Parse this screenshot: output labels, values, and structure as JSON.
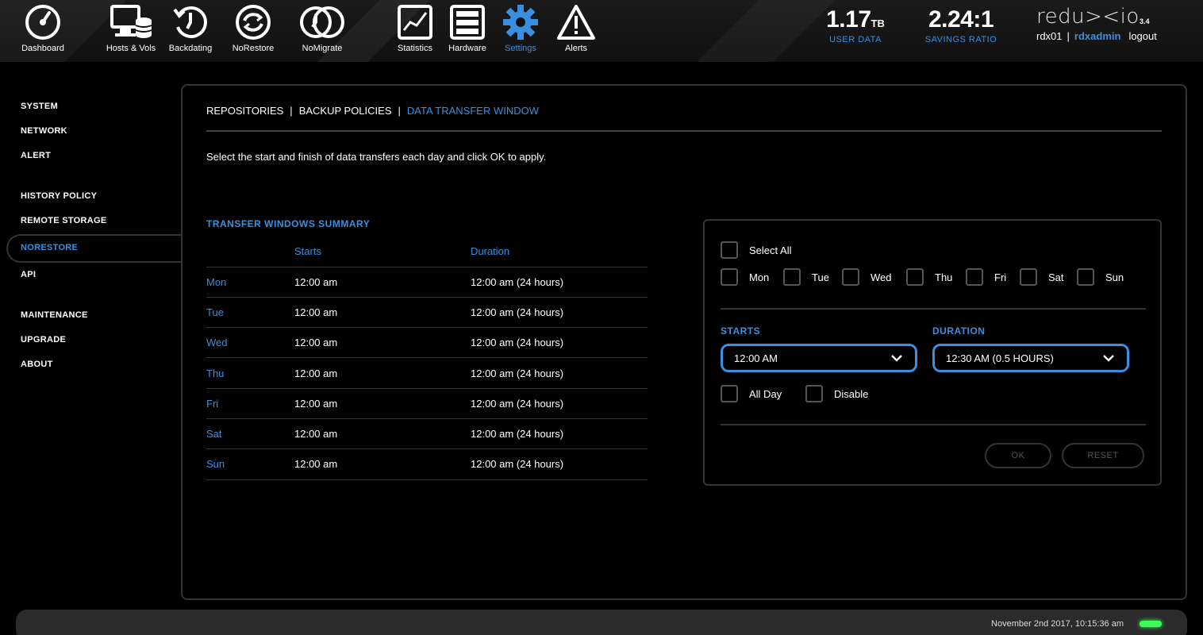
{
  "topnav": {
    "items": [
      {
        "label": "Dashboard",
        "icon": "gauge-icon"
      },
      {
        "label": "Hosts & Vols",
        "icon": "hosts-volumes-icon"
      },
      {
        "label": "Backdating",
        "icon": "backdating-clock-icon"
      },
      {
        "label": "NoRestore",
        "icon": "norestore-icon"
      },
      {
        "label": "NoMigrate",
        "icon": "nomigrate-icon"
      },
      {
        "label": "Statistics",
        "icon": "statistics-chart-icon"
      },
      {
        "label": "Hardware",
        "icon": "hardware-rack-icon"
      },
      {
        "label": "Settings",
        "icon": "gear-icon"
      },
      {
        "label": "Alerts",
        "icon": "warning-icon"
      }
    ],
    "active": "Settings"
  },
  "stats": {
    "user_data": {
      "value": "1.17",
      "unit": "TB",
      "label": "USER DATA"
    },
    "savings": {
      "value": "2.24:1",
      "label": "SAVINGS RATIO"
    }
  },
  "brand": {
    "logo": "redu><io",
    "version": "3.4",
    "system": "rdx01",
    "separator": "|",
    "user": "rdxadmin",
    "logout": "logout"
  },
  "sidebar": {
    "items": [
      "SYSTEM",
      "NETWORK",
      "ALERT",
      "HISTORY POLICY",
      "REMOTE STORAGE",
      "NORESTORE",
      "API",
      "MAINTENANCE",
      "UPGRADE",
      "ABOUT"
    ],
    "active": "NORESTORE"
  },
  "tabs": {
    "items": [
      "REPOSITORIES",
      "BACKUP POLICIES",
      "DATA TRANSFER WINDOW"
    ],
    "separator": "|",
    "active": "DATA TRANSFER WINDOW"
  },
  "instruction": "Select the start and finish of data transfers each day and click OK to apply.",
  "summary": {
    "title": "TRANSFER WINDOWS SUMMARY",
    "headers": [
      "",
      "Starts",
      "Duration"
    ],
    "rows": [
      {
        "day": "Mon",
        "starts": "12:00 am",
        "duration": "12:00 am (24 hours)"
      },
      {
        "day": "Tue",
        "starts": "12:00 am",
        "duration": "12:00 am (24 hours)"
      },
      {
        "day": "Wed",
        "starts": "12:00 am",
        "duration": "12:00 am (24 hours)"
      },
      {
        "day": "Thu",
        "starts": "12:00 am",
        "duration": "12:00 am (24 hours)"
      },
      {
        "day": "Fri",
        "starts": "12:00 am",
        "duration": "12:00 am (24 hours)"
      },
      {
        "day": "Sat",
        "starts": "12:00 am",
        "duration": "12:00 am (24 hours)"
      },
      {
        "day": "Sun",
        "starts": "12:00 am",
        "duration": "12:00 am (24 hours)"
      }
    ]
  },
  "editor": {
    "select_all": "Select All",
    "days": [
      "Mon",
      "Tue",
      "Wed",
      "Thu",
      "Fri",
      "Sat",
      "Sun"
    ],
    "starts_label": "STARTS",
    "starts_value": "12:00 AM",
    "duration_label": "DURATION",
    "duration_value": "12:30 AM (0.5 HOURS)",
    "all_day": "All Day",
    "disable": "Disable",
    "ok": "OK",
    "reset": "RESET"
  },
  "footer": {
    "timestamp": "November 2nd 2017, 10:15:36 am"
  },
  "colors": {
    "accent": "#3a8fe0",
    "background": "#000000",
    "status_led": "#3dff5a"
  }
}
